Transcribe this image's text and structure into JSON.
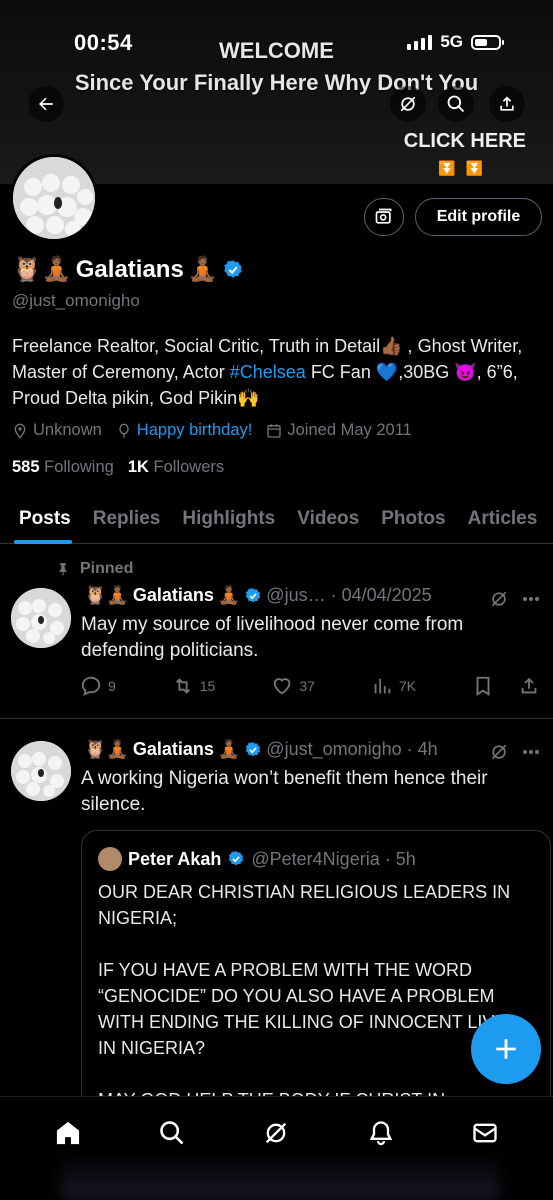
{
  "status_bar": {
    "time": "00:54",
    "network": "5G"
  },
  "banner": {
    "title": "WELCOME",
    "subtitle": "Since Your Finally Here Why Don't You",
    "click_here": "CLICK HERE",
    "arrows": "⏬⏬"
  },
  "profile": {
    "name_prefix": "🦉🧘🏾",
    "name": "Galatians",
    "name_suffix": "🧘🏾",
    "handle": "@just_omonigho",
    "edit_profile_label": "Edit profile",
    "bio_part1": "Freelance Realtor, Social Critic, Truth in Detail👍🏾 , Ghost Writer, Master of Ceremony, Actor ",
    "bio_hashtag": "#Chelsea",
    "bio_part2": " FC Fan 💙,30BG 😈, 6”6, Proud Delta pikin, God Pikin🙌",
    "location": "Unknown",
    "birthday": "Happy birthday!",
    "joined": "Joined May 2011",
    "following_count": "585",
    "following_label": "Following",
    "followers_count": "1K",
    "followers_label": "Followers"
  },
  "tabs": [
    "Posts",
    "Replies",
    "Highlights",
    "Videos",
    "Photos",
    "Articles"
  ],
  "pinned_post": {
    "pinned_label": "Pinned",
    "author_prefix": "🦉🧘🏾",
    "author": "Galatians",
    "author_suffix": "🧘🏾",
    "handle_time": "@jus… · 04/04/2025",
    "text": "May my source of livelihood never come from defending politicians.",
    "replies": "9",
    "reposts": "15",
    "likes": "37",
    "views": "7K"
  },
  "second_post": {
    "author_prefix": "🦉🧘🏾",
    "author": "Galatians",
    "author_suffix": "🧘🏾",
    "handle_time": "@just_omonigho · 4h",
    "text": "A working Nigeria won’t benefit them hence their silence.",
    "quote": {
      "author": "Peter Akah",
      "handle_time": "@Peter4Nigeria · 5h",
      "text": "OUR DEAR CHRISTIAN RELIGIOUS LEADERS IN NIGERIA;\n\nIF YOU HAVE A PROBLEM WITH THE WORD “GENOCIDE” DO YOU ALSO HAVE A PROBLEM WITH ENDING THE KILLING OF INNOCENT LIVES IN NIGERIA?\n\nMAY GOD HELP THE BODY IF CHRIST IN"
    }
  },
  "colors": {
    "accent": "#1d9bf0",
    "muted": "#71767b",
    "border": "#2f3336"
  },
  "icons": [
    "back-arrow-icon",
    "grok-icon",
    "search-icon",
    "share-icon",
    "camera-icon",
    "location-icon",
    "balloon-icon",
    "calendar-icon",
    "pin-icon",
    "verified-icon",
    "reply-icon",
    "repost-icon",
    "like-icon",
    "views-icon",
    "bookmark-icon",
    "more-icon",
    "plus-icon",
    "home-icon",
    "bell-icon",
    "mail-icon"
  ]
}
